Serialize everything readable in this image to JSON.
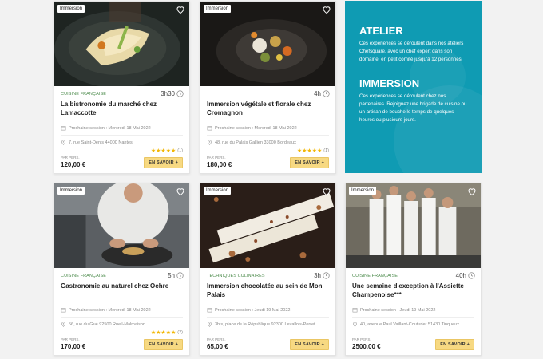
{
  "cards": [
    {
      "tag": "Immersion",
      "category": "CUISINE FRANÇAISE",
      "duration": "3h30",
      "title": "La bistronomie du marché chez Lamaccotte",
      "session": "Prochaine session : Mercredi 18 Mai 2022",
      "address": "7, rue Saint-Denis 44000 Nantes",
      "rating": "★★★★★",
      "rating_count": "(1)",
      "price_label": "PAR PERS.",
      "price": "120,00 €",
      "cta": "EN SAVOIR +"
    },
    {
      "tag": "Immersion",
      "category": "",
      "duration": "4h",
      "title": "Immersion végétale et florale chez Cromagnon",
      "session": "Prochaine session : Mercredi 18 Mai 2022",
      "address": "48, rue du Palais Gallien 33000 Bordeaux",
      "rating": "★★★★★",
      "rating_count": "(1)",
      "price_label": "PAR PERS.",
      "price": "180,00 €",
      "cta": "EN SAVOIR +"
    },
    {
      "tag": "Immersion",
      "category": "CUISINE FRANÇAISE",
      "duration": "5h",
      "title": "Gastronomie au naturel chez Ochre",
      "session": "Prochaine session : Mercredi 18 Mai 2022",
      "address": "56, rue du Gué 92500 Rueil-Malmaison",
      "rating": "★★★★★",
      "rating_count": "(2)",
      "price_label": "PAR PERS.",
      "price": "170,00 €",
      "cta": "EN SAVOIR +"
    },
    {
      "tag": "Immersion",
      "category": "TECHNIQUES CULINAIRES",
      "duration": "3h",
      "title": "Immersion chocolatée au sein de Mon Palais",
      "session": "Prochaine session : Jeudi 19 Mai 2022",
      "address": "3bis, place de la République 92300 Levallois-Perret",
      "rating": "",
      "rating_count": "",
      "price_label": "PAR PERS.",
      "price": "65,00 €",
      "cta": "EN SAVOIR +"
    },
    {
      "tag": "Immersion",
      "category": "CUISINE FRANÇAISE",
      "duration": "40h",
      "title": "Une semaine d'exception à l'Assiette Champenoise***",
      "session": "Prochaine session : Jeudi 19 Mai 2022",
      "address": "40, avenue Paul Vaillant-Couturier 51430 Tinqueux",
      "rating": "",
      "rating_count": "",
      "price_label": "PAR PERS.",
      "price": "2500,00 €",
      "cta": "EN SAVOIR +"
    }
  ],
  "panel": {
    "atelier_title": "ATELIER",
    "atelier_text": "Ces expériences se déroulent dans nos ateliers Chefsquare, avec un chef expert dans son domaine, en petit comité jusqu'à 12 personnes.",
    "immersion_title": "IMMERSION",
    "immersion_text": "Ces expériences se déroulent chez nos partenaires. Rejoignez une brigade de cuisine ou un artisan de bouche le temps de quelques heures ou plusieurs jours."
  },
  "colors": {
    "panel_bg": "#0f9bb3",
    "button_bg": "#f7d982",
    "star": "#f2b705",
    "category": "#4a8a4a"
  },
  "icons": [
    "heart-icon",
    "clock-icon",
    "calendar-icon",
    "location-pin-icon",
    "star-icon"
  ]
}
